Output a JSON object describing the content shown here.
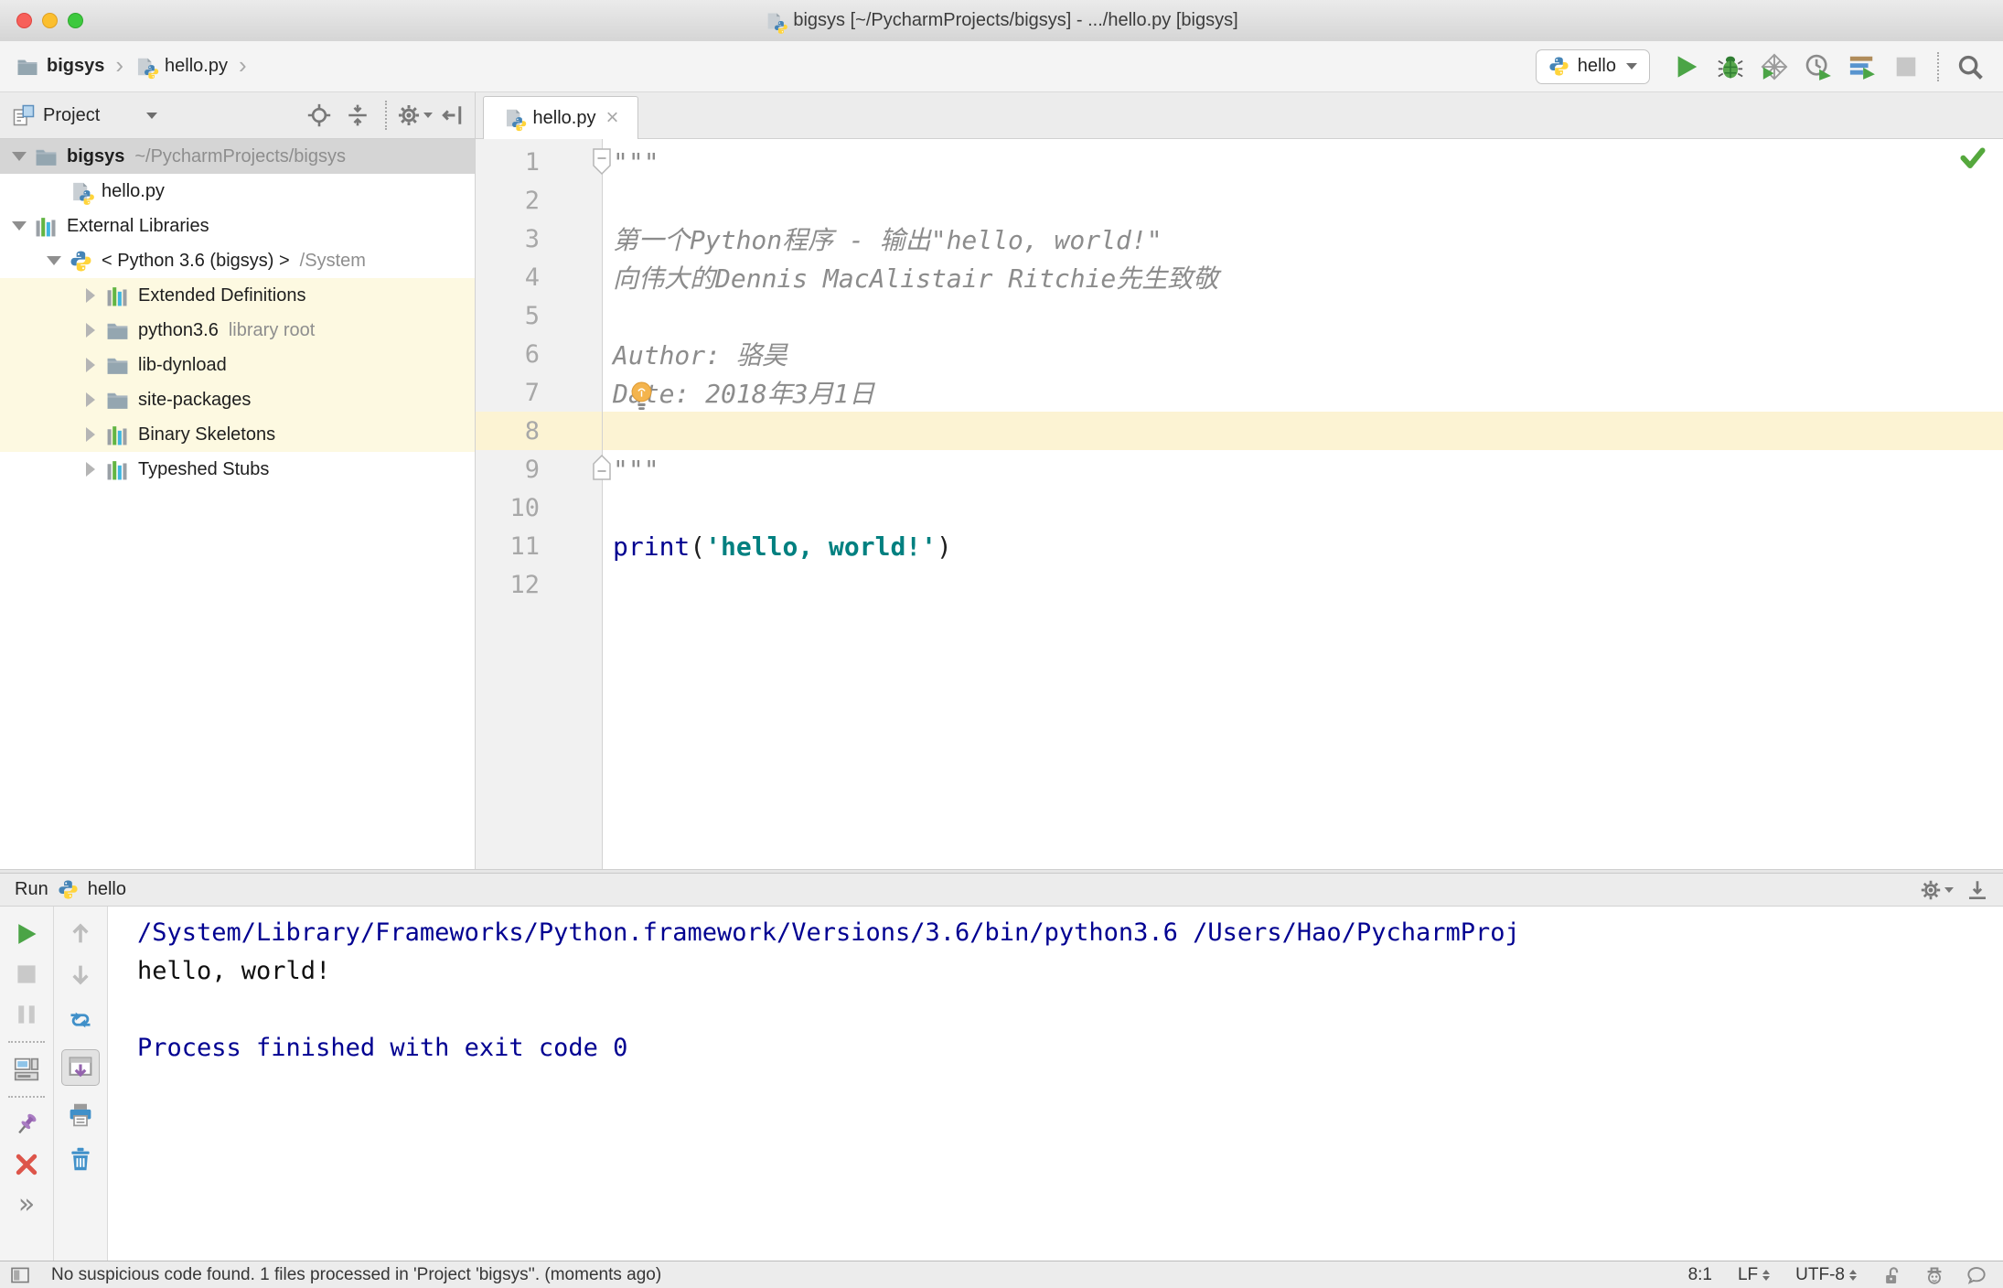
{
  "window": {
    "title": "bigsys [~/PycharmProjects/bigsys] - .../hello.py [bigsys]"
  },
  "navbar": {
    "breadcrumbs": [
      "bigsys",
      "hello.py"
    ],
    "run_config": {
      "label": "hello"
    },
    "actions": [
      "run",
      "debug",
      "run-with-coverage",
      "profiler",
      "concurrency-diagram",
      "stop",
      "div",
      "search"
    ]
  },
  "project_panel": {
    "title": "Project",
    "header_icons": [
      "locate",
      "collapse-all",
      "div",
      "settings",
      "hide"
    ],
    "tree": [
      {
        "label": "bigsys",
        "suffix": "~/PycharmProjects/bigsys",
        "icon": "folder",
        "chevron": "down",
        "level": 0,
        "selected": true,
        "bold": true
      },
      {
        "label": "hello.py",
        "suffix": "",
        "icon": "pyfile",
        "chevron": "none",
        "level": 1
      },
      {
        "label": "External Libraries",
        "suffix": "",
        "icon": "library",
        "chevron": "down",
        "level": 0
      },
      {
        "label": "< Python 3.6 (bigsys) >",
        "suffix": "/System",
        "icon": "python",
        "chevron": "down",
        "level": 1
      },
      {
        "label": "Extended Definitions",
        "suffix": "",
        "icon": "library",
        "chevron": "right",
        "level": 2,
        "highlight": true
      },
      {
        "label": "python3.6",
        "suffix": "library root",
        "icon": "folder",
        "chevron": "right",
        "level": 2,
        "highlight": true
      },
      {
        "label": "lib-dynload",
        "suffix": "",
        "icon": "folder",
        "chevron": "right",
        "level": 2,
        "highlight": true
      },
      {
        "label": "site-packages",
        "suffix": "",
        "icon": "folder",
        "chevron": "right",
        "level": 2,
        "highlight": true
      },
      {
        "label": "Binary Skeletons",
        "suffix": "",
        "icon": "library",
        "chevron": "right",
        "level": 2,
        "highlight": true
      },
      {
        "label": "Typeshed Stubs",
        "suffix": "",
        "icon": "library",
        "chevron": "right",
        "level": 2
      }
    ]
  },
  "editor": {
    "tab": {
      "label": "hello.py"
    },
    "caret_line": 8,
    "lines": [
      {
        "n": 1,
        "tokens": [
          {
            "t": "\"\"\"",
            "s": "doc"
          }
        ]
      },
      {
        "n": 2,
        "tokens": []
      },
      {
        "n": 3,
        "tokens": [
          {
            "t": "第一个Python程序 - 输出\"hello, world!\"",
            "s": "doc"
          }
        ]
      },
      {
        "n": 4,
        "tokens": [
          {
            "t": "向伟大的Dennis MacAlistair Ritchie先生致敬",
            "s": "doc"
          }
        ]
      },
      {
        "n": 5,
        "tokens": []
      },
      {
        "n": 6,
        "tokens": [
          {
            "t": "Author: 骆昊",
            "s": "doc"
          }
        ]
      },
      {
        "n": 7,
        "tokens": [
          {
            "t": "Date: 2018年3月1日",
            "s": "doc"
          }
        ]
      },
      {
        "n": 8,
        "tokens": []
      },
      {
        "n": 9,
        "tokens": [
          {
            "t": "\"\"\"",
            "s": "doc"
          }
        ]
      },
      {
        "n": 10,
        "tokens": []
      },
      {
        "n": 11,
        "tokens": [
          {
            "t": "print",
            "s": "kw"
          },
          {
            "t": "(",
            "s": "pl"
          },
          {
            "t": "'hello, world!'",
            "s": "str"
          },
          {
            "t": ")",
            "s": "pl"
          }
        ]
      },
      {
        "n": 12,
        "tokens": []
      }
    ]
  },
  "run_panel": {
    "title": "Run",
    "config": "hello",
    "header_icons": [
      "settings",
      "hide-down"
    ],
    "toolbar_main": [
      "rerun",
      "stop-disabled",
      "pause",
      "div",
      "restore-layout",
      "div",
      "pin",
      "close",
      "more"
    ],
    "toolbar_console": [
      "up",
      "down",
      "soft-wrap",
      "scroll-end",
      "print",
      "clear"
    ],
    "console": [
      {
        "text": "/System/Library/Frameworks/Python.framework/Versions/3.6/bin/python3.6 /Users/Hao/PycharmProj",
        "style": "system"
      },
      {
        "text": "hello, world!",
        "style": "stdout"
      },
      {
        "text": "",
        "style": "stdout"
      },
      {
        "text": "Process finished with exit code 0",
        "style": "system"
      }
    ]
  },
  "statusbar": {
    "message": "No suspicious code found. 1 files processed in 'Project 'bigsys''. (moments ago)",
    "caret_position": "8:1",
    "line_separator": "LF",
    "encoding": "UTF-8",
    "icons": [
      "lock-open",
      "inspections-profile",
      "event-bubble"
    ]
  },
  "colors": {
    "accent_green": "#4ba446",
    "keyword": "#000090",
    "string": "#008080",
    "doc_comment": "#8c8c8c",
    "console_system": "#000091",
    "tree_highlight": "#fdf9e1",
    "caret_line": "#fcf3d3"
  }
}
